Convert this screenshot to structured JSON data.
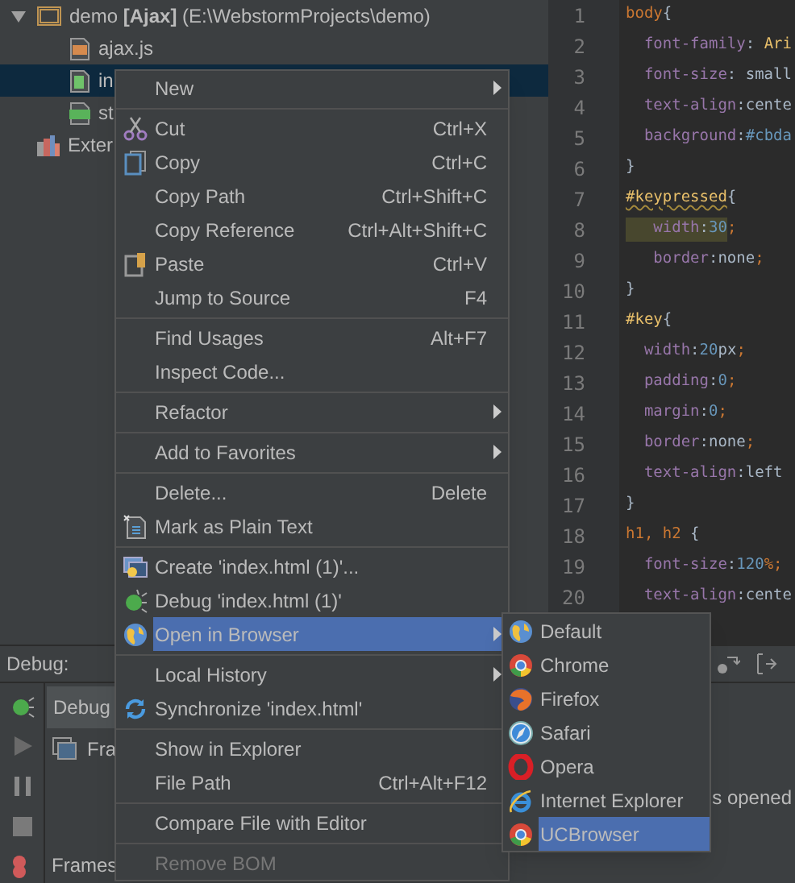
{
  "project_tree": [
    {
      "label": "demo **[Ajax]** (E:\\WebstormProjects\\demo)",
      "kind": "folder",
      "expanded": true,
      "selected": false,
      "children": [
        {
          "label": "ajax.js",
          "kind": "js",
          "selected": false
        },
        {
          "label": "in",
          "kind": "html",
          "selected": true
        },
        {
          "label": "st",
          "kind": "css",
          "selected": false
        }
      ]
    },
    {
      "label": "Exter",
      "kind": "library",
      "selected": false
    }
  ],
  "editor": {
    "lines": [
      {
        "number": "1",
        "tokens": [
          {
            "text": "body",
            "kind": "tag"
          },
          {
            "text": "{",
            "kind": "text"
          }
        ]
      },
      {
        "number": "2",
        "tokens": [
          {
            "text": "  font-family",
            "kind": "prop"
          },
          {
            "text": ": ",
            "kind": "text"
          },
          {
            "text": "Ari",
            "kind": "string"
          }
        ]
      },
      {
        "number": "3",
        "tokens": [
          {
            "text": "  font-size",
            "kind": "prop"
          },
          {
            "text": ": small",
            "kind": "text"
          }
        ]
      },
      {
        "number": "4",
        "tokens": [
          {
            "text": "  text-align",
            "kind": "prop"
          },
          {
            "text": ":cente",
            "kind": "text"
          }
        ]
      },
      {
        "number": "5",
        "tokens": [
          {
            "text": "  background",
            "kind": "prop"
          },
          {
            "text": ":",
            "kind": "text"
          },
          {
            "text": "#cbda",
            "kind": "number"
          }
        ]
      },
      {
        "number": "6",
        "tokens": [
          {
            "text": "}",
            "kind": "text"
          }
        ]
      },
      {
        "number": "7",
        "tokens": [
          {
            "text": "#keypressed",
            "kind": "id-warning"
          },
          {
            "text": "{",
            "kind": "text"
          }
        ]
      },
      {
        "number": "8",
        "tokens": [
          {
            "text": "   width",
            "kind": "prop-highlight"
          },
          {
            "text": ":",
            "kind": "text-highlight"
          },
          {
            "text": "30",
            "kind": "number-highlight"
          },
          {
            "text": ";",
            "kind": "punct"
          }
        ]
      },
      {
        "number": "9",
        "tokens": [
          {
            "text": "   border",
            "kind": "prop"
          },
          {
            "text": ":none",
            "kind": "text"
          },
          {
            "text": ";",
            "kind": "punct"
          }
        ]
      },
      {
        "number": "10",
        "tokens": [
          {
            "text": "}",
            "kind": "text"
          }
        ]
      },
      {
        "number": "11",
        "tokens": [
          {
            "text": "#key",
            "kind": "id"
          },
          {
            "text": "{",
            "kind": "text"
          }
        ]
      },
      {
        "number": "12",
        "tokens": [
          {
            "text": "  width",
            "kind": "prop"
          },
          {
            "text": ":",
            "kind": "text"
          },
          {
            "text": "20",
            "kind": "number"
          },
          {
            "text": "px",
            "kind": "text"
          },
          {
            "text": ";",
            "kind": "punct"
          }
        ]
      },
      {
        "number": "13",
        "tokens": [
          {
            "text": "  padding",
            "kind": "prop"
          },
          {
            "text": ":",
            "kind": "text"
          },
          {
            "text": "0",
            "kind": "number"
          },
          {
            "text": ";",
            "kind": "punct"
          }
        ]
      },
      {
        "number": "14",
        "tokens": [
          {
            "text": "  margin",
            "kind": "prop"
          },
          {
            "text": ":",
            "kind": "text"
          },
          {
            "text": "0",
            "kind": "number"
          },
          {
            "text": ";",
            "kind": "punct"
          }
        ]
      },
      {
        "number": "15",
        "tokens": [
          {
            "text": "  border",
            "kind": "prop"
          },
          {
            "text": ":none",
            "kind": "text"
          },
          {
            "text": ";",
            "kind": "punct"
          }
        ]
      },
      {
        "number": "16",
        "tokens": [
          {
            "text": "  text-align",
            "kind": "prop"
          },
          {
            "text": ":left",
            "kind": "text"
          }
        ]
      },
      {
        "number": "17",
        "tokens": [
          {
            "text": "}",
            "kind": "text"
          }
        ]
      },
      {
        "number": "18",
        "tokens": [
          {
            "text": "h1, h2",
            "kind": "tag"
          },
          {
            "text": " {",
            "kind": "text"
          }
        ]
      },
      {
        "number": "19",
        "tokens": [
          {
            "text": "  font-size",
            "kind": "prop"
          },
          {
            "text": ":",
            "kind": "text"
          },
          {
            "text": "120",
            "kind": "number"
          },
          {
            "text": "%;",
            "kind": "punct"
          }
        ]
      },
      {
        "number": "20",
        "tokens": [
          {
            "text": "  text-align",
            "kind": "prop"
          },
          {
            "text": ":cente",
            "kind": "text"
          }
        ]
      }
    ]
  },
  "debug_panel": {
    "title": "Debug:",
    "tab": "Debug",
    "frames_tab": "Fra",
    "frames_label": "Frames",
    "console_text": "s opened"
  },
  "context_menu": {
    "items": [
      {
        "kind": "item",
        "label": "New",
        "submenu": true,
        "selected": false,
        "disabled": false
      },
      {
        "kind": "separator"
      },
      {
        "kind": "item",
        "label": "Cut",
        "shortcut": "Ctrl+X",
        "submenu": false,
        "selected": false,
        "disabled": false
      },
      {
        "kind": "item",
        "label": "Copy",
        "shortcut": "Ctrl+C",
        "submenu": false,
        "selected": false,
        "disabled": false
      },
      {
        "kind": "item",
        "label": "Copy Path",
        "shortcut": "Ctrl+Shift+C",
        "submenu": false,
        "selected": false,
        "disabled": false
      },
      {
        "kind": "item",
        "label": "Copy Reference",
        "shortcut": "Ctrl+Alt+Shift+C",
        "submenu": false,
        "selected": false,
        "disabled": false
      },
      {
        "kind": "item",
        "label": "Paste",
        "shortcut": "Ctrl+V",
        "submenu": false,
        "selected": false,
        "disabled": false
      },
      {
        "kind": "item",
        "label": "Jump to Source",
        "shortcut": "F4",
        "submenu": false,
        "selected": false,
        "disabled": false
      },
      {
        "kind": "separator"
      },
      {
        "kind": "item",
        "label": "Find Usages",
        "shortcut": "Alt+F7",
        "submenu": false,
        "selected": false,
        "disabled": false
      },
      {
        "kind": "item",
        "label": "Inspect Code...",
        "submenu": false,
        "selected": false,
        "disabled": false
      },
      {
        "kind": "separator"
      },
      {
        "kind": "item",
        "label": "Refactor",
        "submenu": true,
        "selected": false,
        "disabled": false
      },
      {
        "kind": "separator"
      },
      {
        "kind": "item",
        "label": "Add to Favorites",
        "submenu": true,
        "selected": false,
        "disabled": false
      },
      {
        "kind": "separator"
      },
      {
        "kind": "item",
        "label": "Delete...",
        "shortcut": "Delete",
        "submenu": false,
        "selected": false,
        "disabled": false
      },
      {
        "kind": "item",
        "label": "Mark as Plain Text",
        "submenu": false,
        "selected": false,
        "disabled": false
      },
      {
        "kind": "separator"
      },
      {
        "kind": "item",
        "label": "Create 'index.html (1)'...",
        "submenu": false,
        "selected": false,
        "disabled": false
      },
      {
        "kind": "item",
        "label": "Debug 'index.html (1)'",
        "submenu": false,
        "selected": false,
        "disabled": false
      },
      {
        "kind": "item",
        "label": "Open in Browser",
        "submenu": true,
        "selected": true,
        "disabled": false
      },
      {
        "kind": "separator"
      },
      {
        "kind": "item",
        "label": "Local History",
        "submenu": true,
        "selected": false,
        "disabled": false
      },
      {
        "kind": "item",
        "label": "Synchronize 'index.html'",
        "submenu": false,
        "selected": false,
        "disabled": false
      },
      {
        "kind": "separator"
      },
      {
        "kind": "item",
        "label": "Show in Explorer",
        "submenu": false,
        "selected": false,
        "disabled": false
      },
      {
        "kind": "item",
        "label": "File Path",
        "shortcut": "Ctrl+Alt+F12",
        "submenu": false,
        "selected": false,
        "disabled": false
      },
      {
        "kind": "separator"
      },
      {
        "kind": "item",
        "label": "Compare File with Editor",
        "submenu": false,
        "selected": false,
        "disabled": false
      },
      {
        "kind": "separator"
      },
      {
        "kind": "item",
        "label": "Remove BOM",
        "submenu": false,
        "selected": false,
        "disabled": true
      }
    ]
  },
  "browser_submenu": {
    "items": [
      {
        "label": "Default",
        "selected": false
      },
      {
        "label": "Chrome",
        "selected": false
      },
      {
        "label": "Firefox",
        "selected": false
      },
      {
        "label": "Safari",
        "selected": false
      },
      {
        "label": "Opera",
        "selected": false
      },
      {
        "label": "Internet Explorer",
        "selected": false
      },
      {
        "label": "UCBrowser",
        "selected": true
      }
    ]
  }
}
